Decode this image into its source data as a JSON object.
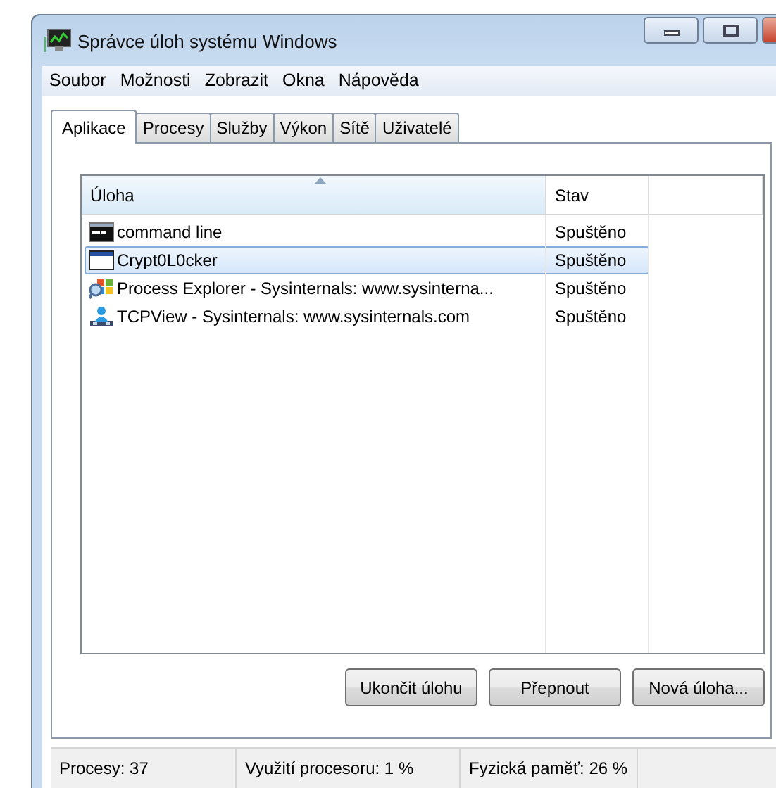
{
  "window": {
    "title": "Správce úloh systému Windows"
  },
  "menu": [
    "Soubor",
    "Možnosti",
    "Zobrazit",
    "Okna",
    "Nápověda"
  ],
  "tabs": [
    {
      "label": "Aplikace",
      "selected": true
    },
    {
      "label": "Procesy",
      "selected": false
    },
    {
      "label": "Služby",
      "selected": false
    },
    {
      "label": "Výkon",
      "selected": false
    },
    {
      "label": "Sítě",
      "selected": false
    },
    {
      "label": "Uživatelé",
      "selected": false
    }
  ],
  "table": {
    "columns": [
      {
        "label": "Úloha",
        "sorted": true
      },
      {
        "label": "Stav",
        "sorted": false
      }
    ],
    "rows": [
      {
        "kind": "console",
        "task": "command line",
        "status": "Spuštěno",
        "selected": false
      },
      {
        "kind": "window",
        "task": "Crypt0L0cker",
        "status": "Spuštěno",
        "selected": true
      },
      {
        "kind": "explorer",
        "task": "Process Explorer - Sysinternals: www.sysinterna...",
        "status": "Spuštěno",
        "selected": false
      },
      {
        "kind": "network",
        "task": "TCPView - Sysinternals: www.sysinternals.com",
        "status": "Spuštěno",
        "selected": false
      }
    ]
  },
  "buttons": [
    "Ukončit úlohu",
    "Přepnout",
    "Nová úloha..."
  ],
  "status_bar": [
    "Procesy: 37",
    "Využití procesoru: 1 %",
    "Fyzická paměť: 26 %"
  ]
}
